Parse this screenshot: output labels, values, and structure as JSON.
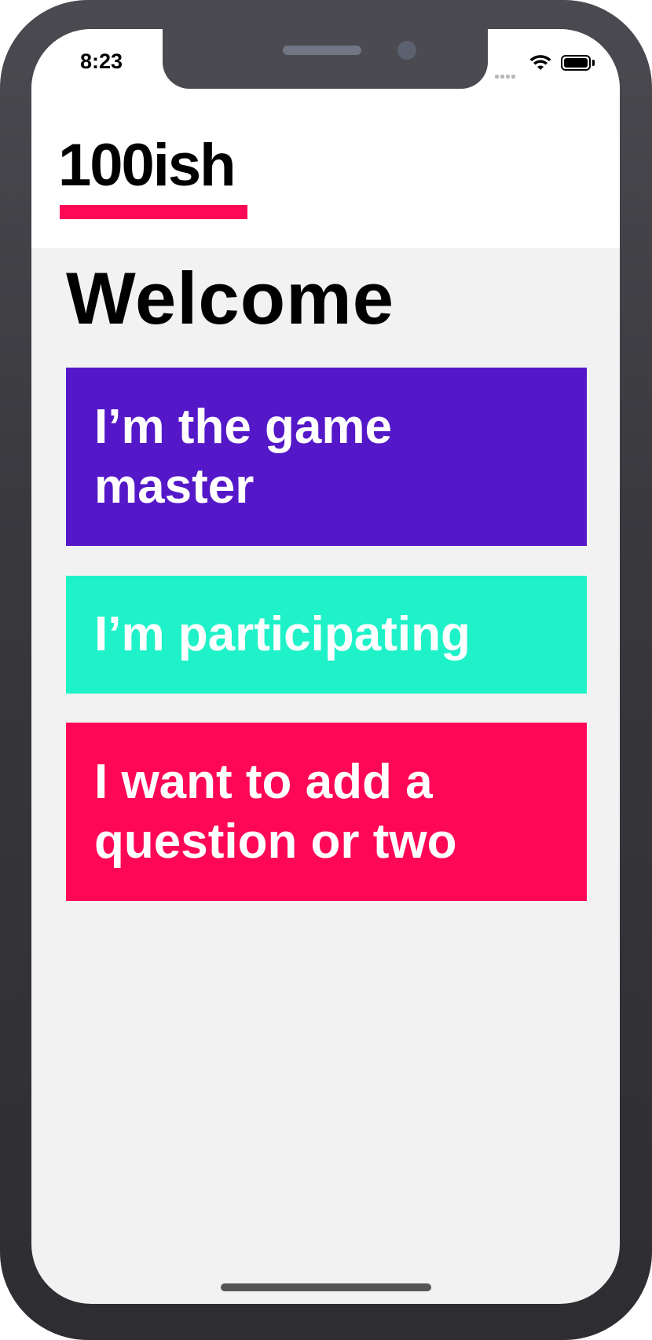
{
  "status_bar": {
    "time": "8:23",
    "icons": [
      "cellular-signal-icon",
      "wifi-icon",
      "battery-icon"
    ]
  },
  "header": {
    "logo_text": "100ish",
    "accent_color": "#ff0757"
  },
  "main": {
    "title": "Welcome",
    "buttons": [
      {
        "label": "I’m the game master",
        "color": "#5518c8"
      },
      {
        "label": "I’m participating",
        "color": "#1ff2c8"
      },
      {
        "label": "I want to add a question or two",
        "color": "#ff0757"
      }
    ]
  }
}
